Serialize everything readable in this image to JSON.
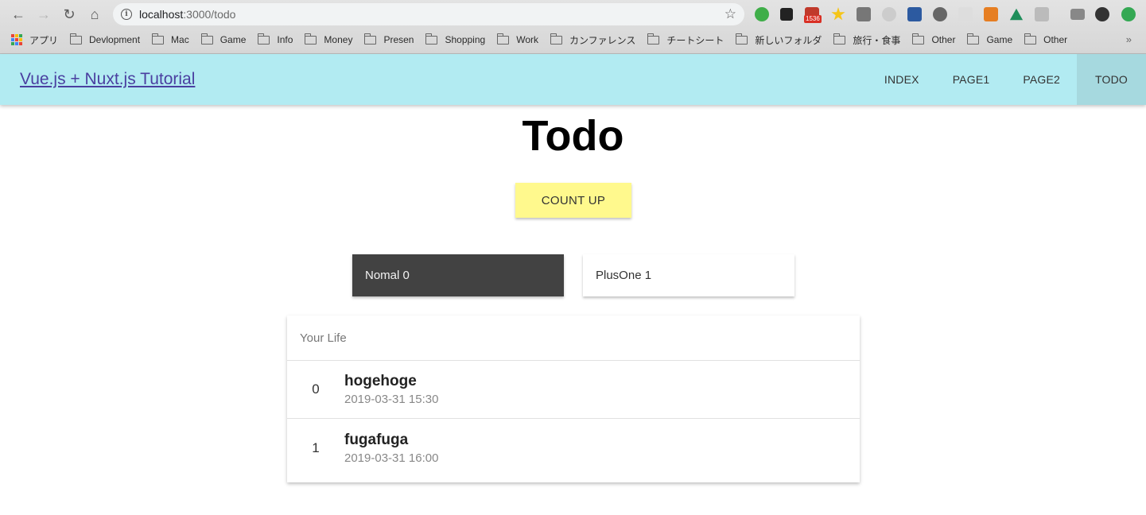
{
  "browser": {
    "url_host": "localhost",
    "url_path": ":3000/todo",
    "extension_badge": "1536",
    "bookmarks": [
      "アプリ",
      "Devlopment",
      "Mac",
      "Game",
      "Info",
      "Money",
      "Presen",
      "Shopping",
      "Work",
      "カンファレンス",
      "チートシート",
      "新しいフォルダ",
      "旅行・食事",
      "Other",
      "Game",
      "Other"
    ],
    "more_bookmarks": "»"
  },
  "header": {
    "brand": "Vue.js + Nuxt.js Tutorial",
    "nav": [
      {
        "label": "INDEX"
      },
      {
        "label": "PAGE1"
      },
      {
        "label": "PAGE2"
      },
      {
        "label": "TODO"
      }
    ],
    "active_nav": "TODO",
    "background_color": "#b2ebf2"
  },
  "main": {
    "title": "Todo",
    "count_button": "COUNT UP",
    "counters": {
      "normal": "Nomal 0",
      "plus_one": "PlusOne 1"
    },
    "list": {
      "header": "Your Life",
      "items": [
        {
          "index": "0",
          "title": "hogehoge",
          "date": "2019-03-31 15:30"
        },
        {
          "index": "1",
          "title": "fugafuga",
          "date": "2019-03-31 16:00"
        }
      ]
    }
  },
  "colors": {
    "accent_button": "#fff98d",
    "dark_card": "#424242",
    "brand_link": "#4a3fa0"
  }
}
